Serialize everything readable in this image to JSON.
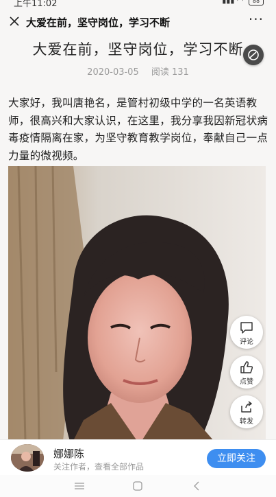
{
  "status": {
    "time": "上午11:02",
    "battery": "88"
  },
  "nav": {
    "title": "大爱在前，坚守岗位，学习不断",
    "more": "···"
  },
  "article": {
    "title": "大爱在前，坚守岗位，学习不断",
    "date": "2020-03-05",
    "read_label": "阅读 131",
    "intro": "大家好，我叫唐艳名，是管村初级中学的一名英语教师，很高兴和大家认识，在这里，我分享我因新冠状病毒疫情隔离在家，为坚守教育教学岗位，奉献自己一点力量的微视频。"
  },
  "side_actions": {
    "comment": "评论",
    "like": "点赞",
    "share": "转发"
  },
  "author": {
    "name": "娜娜陈",
    "subtitle": "关注作者，查看全部作品",
    "follow": "立即关注"
  },
  "colors": {
    "accent": "#3e8ef0",
    "meta_gray": "#9a9a9a"
  },
  "icons": [
    "close-icon",
    "more-icon",
    "music-disc-icon",
    "comment-icon",
    "like-icon",
    "share-icon",
    "menu-icon",
    "home-icon",
    "back-icon"
  ]
}
